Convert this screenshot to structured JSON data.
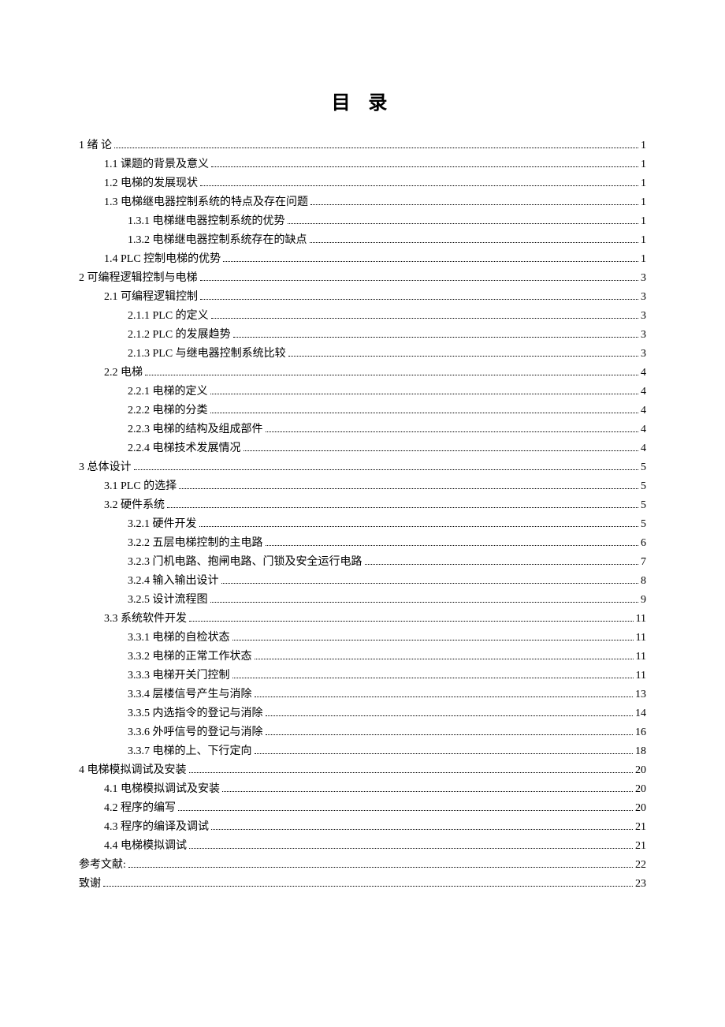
{
  "title": "目  录",
  "entries": [
    {
      "label": "1  绪   论",
      "page": "1",
      "indent": 0,
      "extra_dots": true
    },
    {
      "label": "1.1 课题的背景及意义",
      "page": "1",
      "indent": 1
    },
    {
      "label": "1.2 电梯的发展现状",
      "page": "1",
      "indent": 1
    },
    {
      "label": "1.3 电梯继电器控制系统的特点及存在问题",
      "page": "1",
      "indent": 1
    },
    {
      "label": "1.3.1 电梯继电器控制系统的优势",
      "page": "1",
      "indent": 2
    },
    {
      "label": "1.3.2 电梯继电器控制系统存在的缺点",
      "page": "1",
      "indent": 2
    },
    {
      "label": "1.4 PLC 控制电梯的优势",
      "page": "1",
      "indent": 1
    },
    {
      "label": "2  可编程逻辑控制与电梯",
      "page": "3",
      "indent": 0
    },
    {
      "label": "2.1 可编程逻辑控制",
      "page": "3",
      "indent": 1
    },
    {
      "label": "2.1.1 PLC 的定义",
      "page": "3",
      "indent": 2
    },
    {
      "label": "2.1.2 PLC 的发展趋势",
      "page": "3",
      "indent": 2
    },
    {
      "label": "2.1.3 PLC 与继电器控制系统比较",
      "page": "3",
      "indent": 2
    },
    {
      "label": "2.2 电梯",
      "page": "4",
      "indent": 1
    },
    {
      "label": "2.2.1 电梯的定义",
      "page": "4",
      "indent": 2
    },
    {
      "label": "2.2.2 电梯的分类",
      "page": "4",
      "indent": 2
    },
    {
      "label": "2.2.3 电梯的结构及组成部件",
      "page": "4",
      "indent": 2
    },
    {
      "label": "2.2.4 电梯技术发展情况",
      "page": "4",
      "indent": 2
    },
    {
      "label": "3 总体设计",
      "page": "5",
      "indent": 3
    },
    {
      "label": "3.1 PLC 的选择",
      "page": "5",
      "indent": 1
    },
    {
      "label": "3.2 硬件系统",
      "page": "5",
      "indent": 1
    },
    {
      "label": "3.2.1 硬件开发",
      "page": "5",
      "indent": 2
    },
    {
      "label": "3.2.2 五层电梯控制的主电路",
      "page": "6",
      "indent": 2
    },
    {
      "label": "3.2.3 门机电路、抱闸电路、门锁及安全运行电路",
      "page": "7",
      "indent": 2
    },
    {
      "label": "3.2.4 输入输出设计",
      "page": "8",
      "indent": 2
    },
    {
      "label": "3.2.5 设计流程图",
      "page": "9",
      "indent": 2
    },
    {
      "label": "3.3 系统软件开发",
      "page": "11",
      "indent": 1
    },
    {
      "label": "3.3.1 电梯的自检状态",
      "page": "11",
      "indent": 2
    },
    {
      "label": "3.3.2 电梯的正常工作状态",
      "page": "11",
      "indent": 2
    },
    {
      "label": "3.3.3 电梯开关门控制",
      "page": "11",
      "indent": 2
    },
    {
      "label": "3.3.4 层楼信号产生与消除",
      "page": "13",
      "indent": 2
    },
    {
      "label": "3.3.5 内选指令的登记与消除",
      "page": "14",
      "indent": 2
    },
    {
      "label": "3.3.6 外呼信号的登记与消除",
      "page": "16",
      "indent": 2
    },
    {
      "label": "3.3.7 电梯的上、下行定向",
      "page": "18",
      "indent": 2
    },
    {
      "label": "4  电梯模拟调试及安装",
      "page": "20",
      "indent": 0
    },
    {
      "label": "4.1 电梯模拟调试及安装",
      "page": "20",
      "indent": 1
    },
    {
      "label": "4.2 程序的编写",
      "page": "20",
      "indent": 1
    },
    {
      "label": "4.3 程序的编译及调试",
      "page": "21",
      "indent": 1
    },
    {
      "label": "4.4 电梯模拟调试",
      "page": "21",
      "indent": 1
    },
    {
      "label": "参考文献:",
      "page": "22",
      "indent": 3
    },
    {
      "label": "致谢",
      "page": "23",
      "indent": 3
    }
  ]
}
